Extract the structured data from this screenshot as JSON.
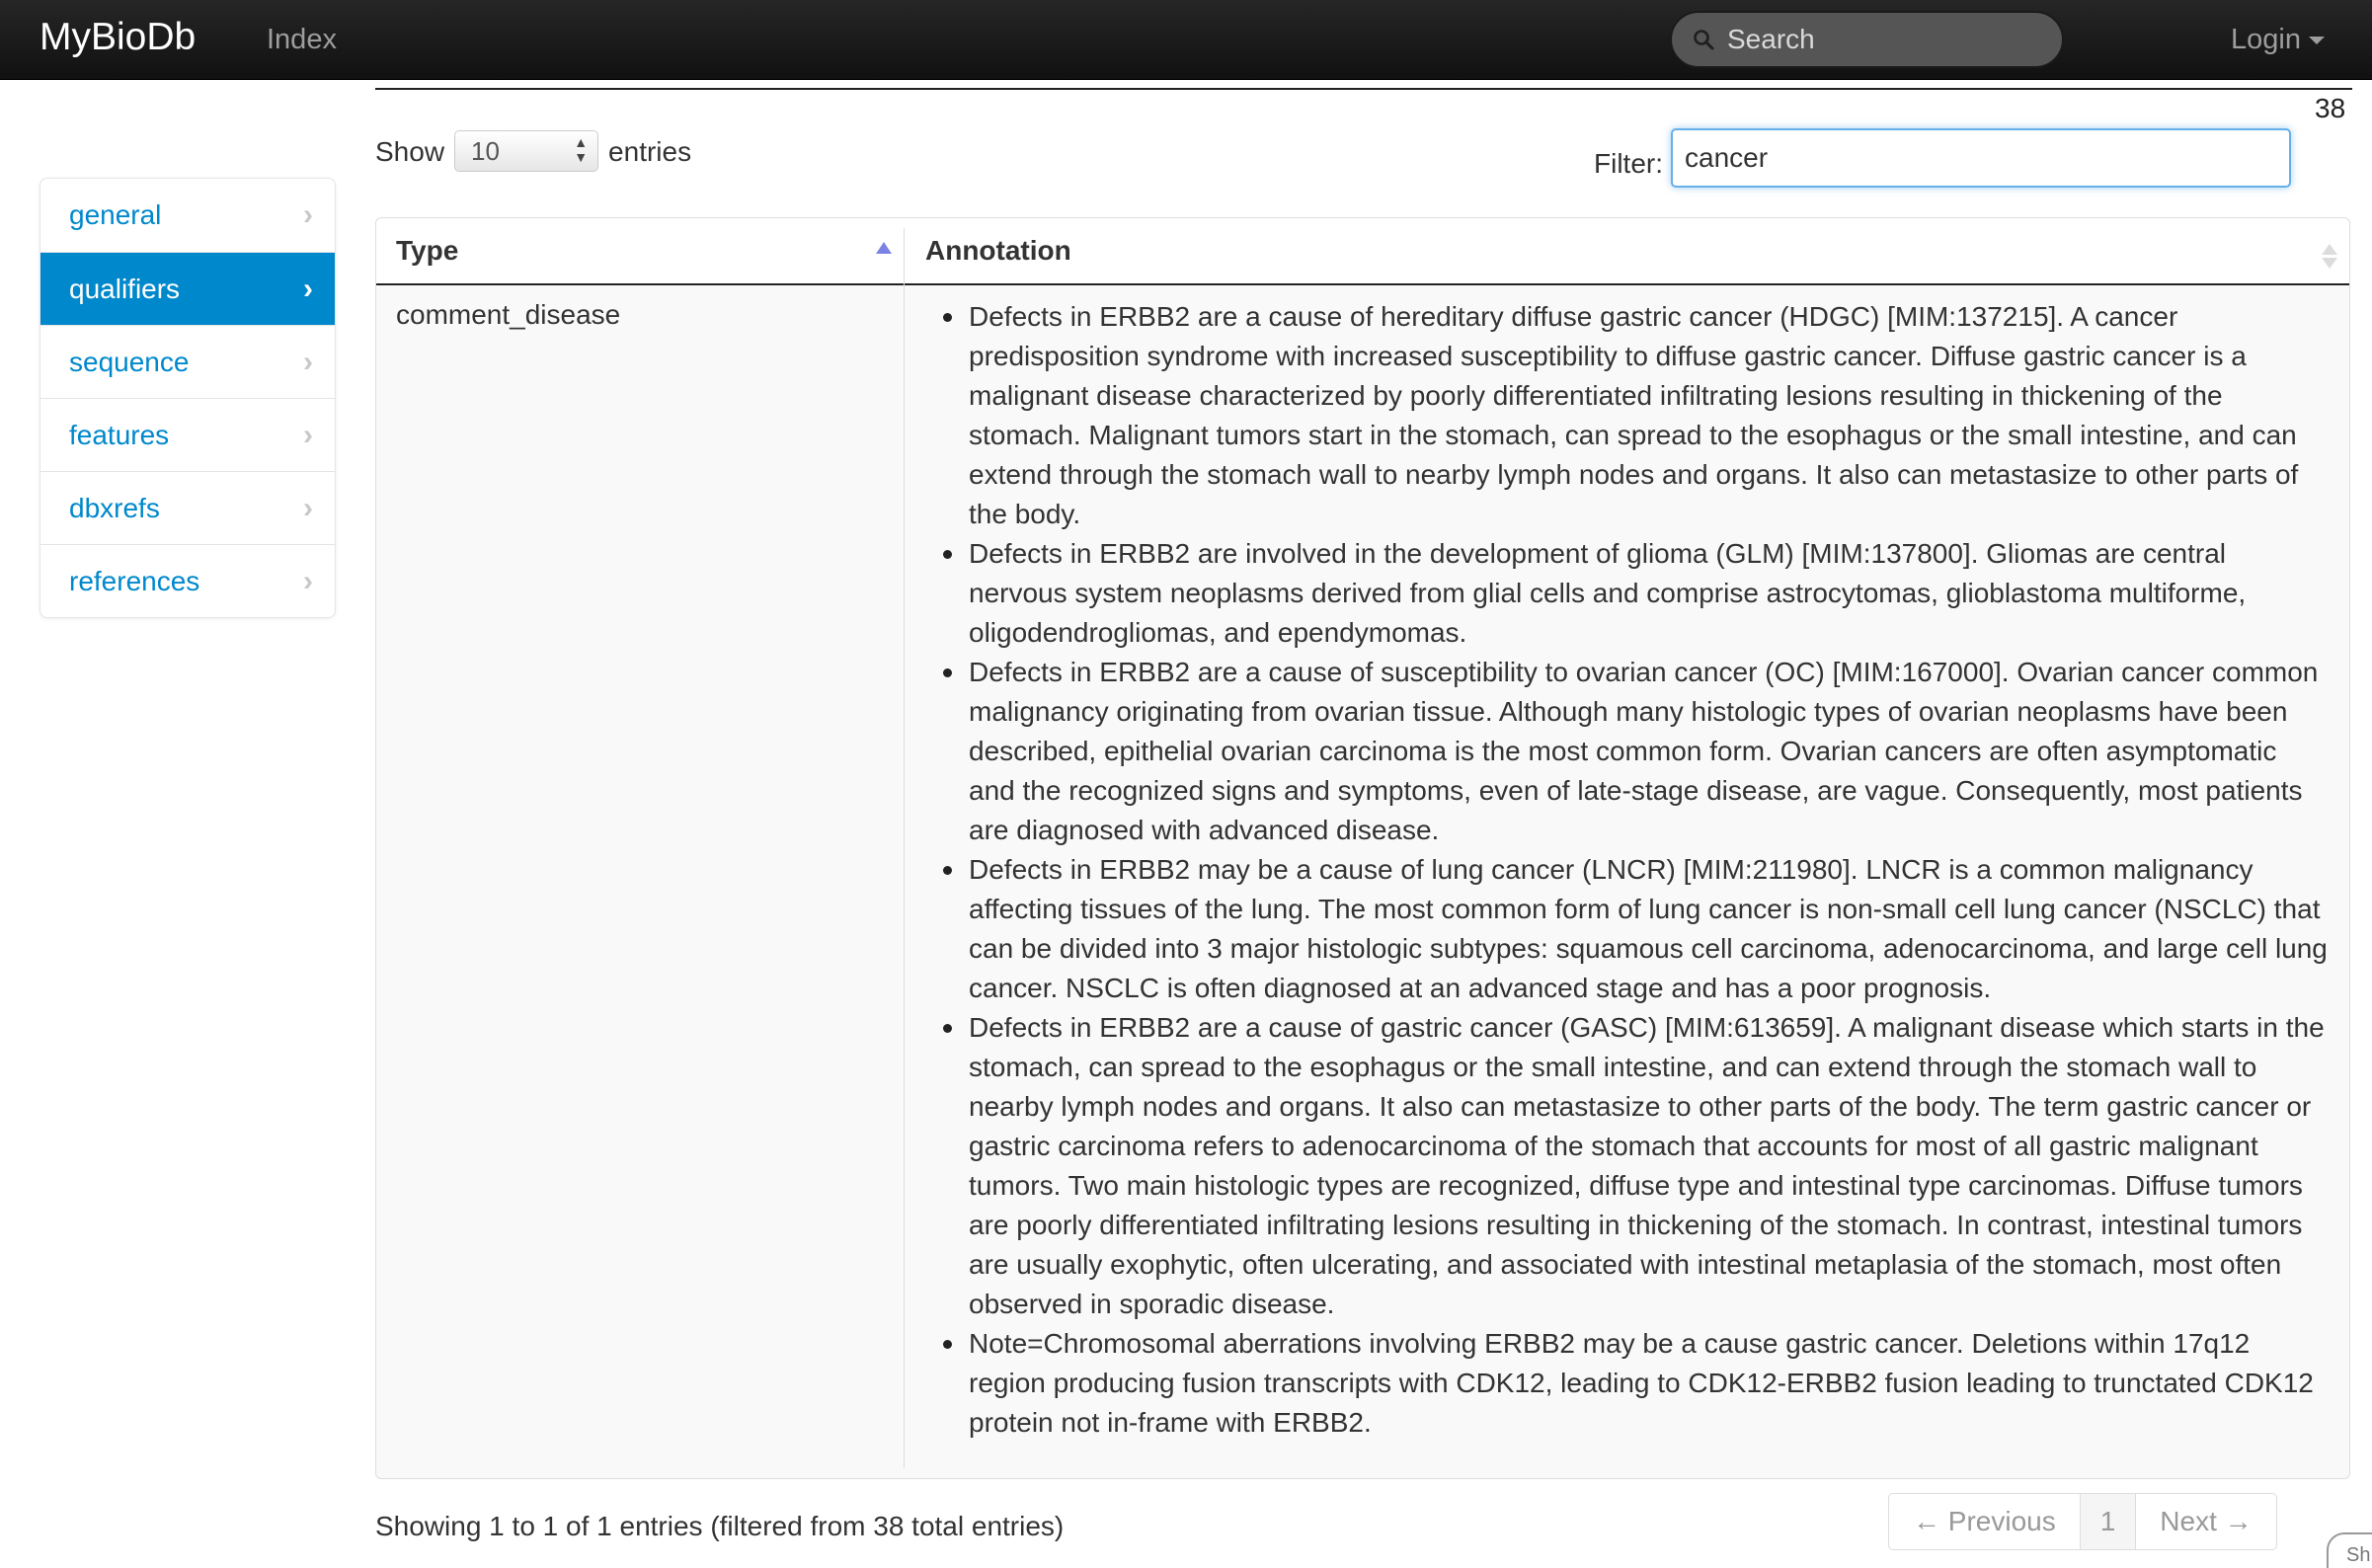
{
  "navbar": {
    "brand": "MyBioDb",
    "index_link": "Index",
    "search_placeholder": "Search",
    "login_label": "Login"
  },
  "record_count": "38",
  "sidebar": {
    "items": [
      {
        "label": "general",
        "active": false
      },
      {
        "label": "qualifiers",
        "active": true
      },
      {
        "label": "sequence",
        "active": false
      },
      {
        "label": "features",
        "active": false
      },
      {
        "label": "dbxrefs",
        "active": false
      },
      {
        "label": "references",
        "active": false
      }
    ]
  },
  "table_controls": {
    "show_label": "Show",
    "page_size": "10",
    "entries_label": "entries",
    "filter_label": "Filter:",
    "filter_value": "cancer"
  },
  "table": {
    "columns": [
      "Type",
      "Annotation"
    ],
    "rows": [
      {
        "type": "comment_disease",
        "annotations": [
          "Defects in ERBB2 are a cause of hereditary diffuse gastric cancer (HDGC) [MIM:137215]. A cancer predisposition syndrome with increased susceptibility to diffuse gastric cancer. Diffuse gastric cancer is a malignant disease characterized by poorly differentiated infiltrating lesions resulting in thickening of the stomach. Malignant tumors start in the stomach, can spread to the esophagus or the small intestine, and can extend through the stomach wall to nearby lymph nodes and organs. It also can metastasize to other parts of the body.",
          "Defects in ERBB2 are involved in the development of glioma (GLM) [MIM:137800]. Gliomas are central nervous system neoplasms derived from glial cells and comprise astrocytomas, glioblastoma multiforme, oligodendrogliomas, and ependymomas.",
          "Defects in ERBB2 are a cause of susceptibility to ovarian cancer (OC) [MIM:167000]. Ovarian cancer common malignancy originating from ovarian tissue. Although many histologic types of ovarian neoplasms have been described, epithelial ovarian carcinoma is the most common form. Ovarian cancers are often asymptomatic and the recognized signs and symptoms, even of late-stage disease, are vague. Consequently, most patients are diagnosed with advanced disease.",
          "Defects in ERBB2 may be a cause of lung cancer (LNCR) [MIM:211980]. LNCR is a common malignancy affecting tissues of the lung. The most common form of lung cancer is non-small cell lung cancer (NSCLC) that can be divided into 3 major histologic subtypes: squamous cell carcinoma, adenocarcinoma, and large cell lung cancer. NSCLC is often diagnosed at an advanced stage and has a poor prognosis.",
          "Defects in ERBB2 are a cause of gastric cancer (GASC) [MIM:613659]. A malignant disease which starts in the stomach, can spread to the esophagus or the small intestine, and can extend through the stomach wall to nearby lymph nodes and organs. It also can metastasize to other parts of the body. The term gastric cancer or gastric carcinoma refers to adenocarcinoma of the stomach that accounts for most of all gastric malignant tumors. Two main histologic types are recognized, diffuse type and intestinal type carcinomas. Diffuse tumors are poorly differentiated infiltrating lesions resulting in thickening of the stomach. In contrast, intestinal tumors are usually exophytic, often ulcerating, and associated with intestinal metaplasia of the stomach, most often observed in sporadic disease.",
          "Note=Chromosomal aberrations involving ERBB2 may be a cause gastric cancer. Deletions within 17q12 region producing fusion transcripts with CDK12, leading to CDK12-ERBB2 fusion leading to trunctated CDK12 protein not in-frame with ERBB2."
        ]
      }
    ]
  },
  "footer": {
    "info": "Showing 1 to 1 of 1 entries (filtered from 38 total entries)",
    "previous": "← Previous",
    "current_page": "1",
    "next": "Next →",
    "corner_label": "Sh"
  },
  "colors": {
    "accent": "#0088cc",
    "navbar": "#1b1b1b",
    "filter_focus": "#66afe9"
  }
}
